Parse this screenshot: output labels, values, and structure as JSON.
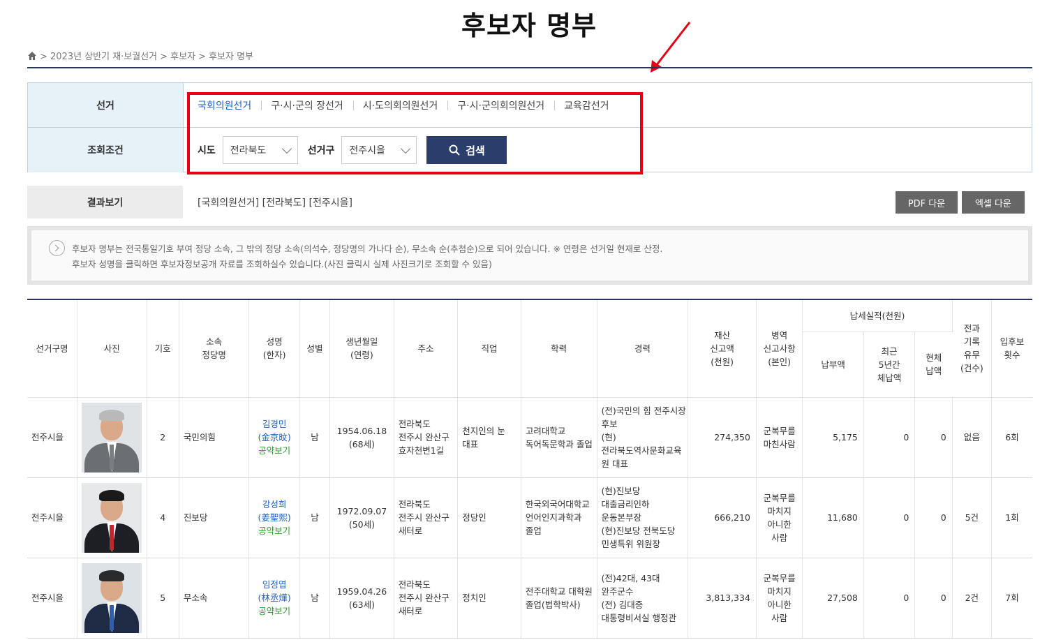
{
  "page": {
    "title": "후보자 명부"
  },
  "breadcrumb": [
    "> 2023년 상반기 재·보궐선거",
    "> 후보자",
    "> 후보자 명부"
  ],
  "search": {
    "election_label": "선거",
    "election_tabs": [
      "국회의원선거",
      "구·시·군의 장선거",
      "시·도의회의원선거",
      "구·시·군의회의원선거",
      "교육감선거"
    ],
    "active_tab": "국회의원선거",
    "condition_label": "조회조건",
    "sido_label": "시도",
    "sido_value": "전라북도",
    "district_label": "선거구",
    "district_value": "전주시을",
    "search_button": "검색"
  },
  "result": {
    "label": "결과보기",
    "summary": "[국회의원선거] [전라북도] [전주시을]",
    "pdf_button": "PDF 다운",
    "excel_button": "엑셀 다운"
  },
  "notice": {
    "line1": "후보자 명부는 전국통일기호 부여 정당 소속, 그 밖의 정당 소속(의석수, 정당명의 가나다 순), 무소속 순(추첨순)으로 되어 있습니다. ※ 연령은 선거일 현재로 산정.",
    "line2": "후보자 성명을 클릭하면 후보자정보공개 자료를 조회하실수 있습니다.(사진 클릭시 실제 사진크기로 조회할 수 있음)"
  },
  "table": {
    "headers": {
      "district": "선거구명",
      "photo": "사진",
      "number": "기호",
      "party_l1": "소속",
      "party_l2": "정당명",
      "name_l1": "성명",
      "name_l2": "(한자)",
      "gender": "성별",
      "birth_l1": "생년월일",
      "birth_l2": "(연령)",
      "address": "주소",
      "job": "직업",
      "education": "학력",
      "career": "경력",
      "assets_l1": "재산",
      "assets_l2": "신고액",
      "assets_l3": "(천원)",
      "military_l1": "병역",
      "military_l2": "신고사항",
      "military_l3": "(본인)",
      "tax_group": "납세실적(천원)",
      "tax_paid": "납부액",
      "tax_overdue_l1": "최근",
      "tax_overdue_l2": "5년간",
      "tax_overdue_l3": "체납액",
      "tax_current_l1": "현체",
      "tax_current_l2": "납액",
      "record_l1": "전과",
      "record_l2": "기록",
      "record_l3": "유무",
      "record_l4": "(건수)",
      "runs_l1": "입후보",
      "runs_l2": "횟수"
    },
    "rows": [
      {
        "district": "전주시을",
        "number": "2",
        "party": "국민의힘",
        "name": "김경민",
        "hanja": "(金京旼)",
        "pledge": "공약보기",
        "gender": "남",
        "birth": "1954.06.18",
        "age": "(68세)",
        "address": [
          "전라북도",
          "전주시 완산구",
          "효자천변1길"
        ],
        "job": [
          "천지인의 눈",
          "대표"
        ],
        "education": [
          "고려대학교",
          "독어독문학과 졸업"
        ],
        "career": [
          "(전)국민의 힘 전주시장",
          "후보",
          "(현)",
          "전라북도역사문화교육",
          "원 대표"
        ],
        "assets": "274,350",
        "military": [
          "군복무를",
          "마친사람"
        ],
        "tax_paid": "5,175",
        "tax_overdue": "0",
        "tax_current": "0",
        "record": "없음",
        "runs": "6회",
        "photo": {
          "bg": "#dfe3e6",
          "suit": "#6b6e73",
          "hair": "#b9b9b9",
          "tie": "#7a7d82"
        }
      },
      {
        "district": "전주시을",
        "number": "4",
        "party": "진보당",
        "name": "강성희",
        "hanja": "(姜聖熙)",
        "pledge": "공약보기",
        "gender": "남",
        "birth": "1972.09.07",
        "age": "(50세)",
        "address": [
          "전라북도",
          "전주시 완산구",
          "새터로"
        ],
        "job": [
          "정당인"
        ],
        "education": [
          "한국외국어대학교",
          "언어인지과학과",
          "졸업"
        ],
        "career": [
          "(현)진보당",
          "대출금리인하",
          "운동본부장",
          "(현)진보당 전북도당",
          "민생특위 위원장"
        ],
        "assets": "666,210",
        "military": [
          "군복무를",
          "마치지",
          "아니한",
          "사람"
        ],
        "tax_paid": "11,680",
        "tax_overdue": "0",
        "tax_current": "0",
        "record": "5건",
        "runs": "1회",
        "photo": {
          "bg": "#e6e8ea",
          "suit": "#1d1f25",
          "hair": "#1a1a1a",
          "tie": "#c0272d"
        }
      },
      {
        "district": "전주시을",
        "number": "5",
        "party": "무소속",
        "name": "임정엽",
        "hanja": "(林丞燁)",
        "pledge": "공약보기",
        "gender": "남",
        "birth": "1959.04.26",
        "age": "(63세)",
        "address": [
          "전라북도",
          "전주시 완산구",
          "새터로"
        ],
        "job": [
          "정치인"
        ],
        "education": [
          "전주대학교 대학원",
          "졸업(법학박사)"
        ],
        "career": [
          "(전)42대, 43대",
          "완주군수",
          "(전) 김대중",
          "대통령비서실 행정관"
        ],
        "assets": "3,813,334",
        "military": [
          "군복무를",
          "마치지",
          "아니한",
          "사람"
        ],
        "tax_paid": "27,508",
        "tax_overdue": "0",
        "tax_current": "0",
        "record": "2건",
        "runs": "7회",
        "photo": {
          "bg": "#dde2e6",
          "suit": "#1f2a44",
          "hair": "#2a2a2a",
          "tie": "#2f5fa8"
        }
      }
    ]
  },
  "colors": {
    "accent": "#1a5fc8",
    "navy": "#2b3e6b",
    "highlight": "#e60012",
    "pledge": "#2a9d2a"
  }
}
